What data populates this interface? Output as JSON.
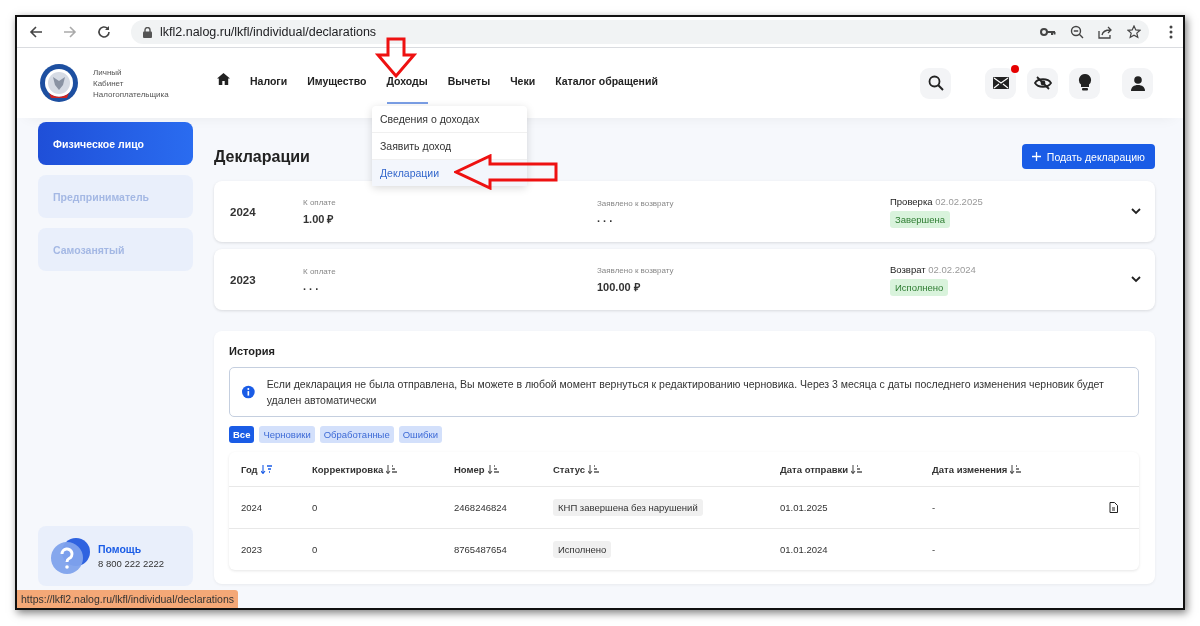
{
  "browser": {
    "url": "lkfl2.nalog.ru/lkfl/individual/declarations",
    "status_url": "https://lkfl2.nalog.ru/lkfl/individual/declarations"
  },
  "logo_text": [
    "Личный",
    "Кабинет",
    "Налогоплательщика"
  ],
  "nav": [
    {
      "label": "Налоги",
      "selected": false
    },
    {
      "label": "Имущество",
      "selected": false
    },
    {
      "label": "Доходы",
      "selected": true
    },
    {
      "label": "Вычеты",
      "selected": false
    },
    {
      "label": "Чеки",
      "selected": false
    },
    {
      "label": "Каталог обращений",
      "selected": false
    }
  ],
  "header_icons": [
    {
      "kind": "search",
      "badge": false
    },
    {
      "kind": "mail",
      "badge": true
    },
    {
      "kind": "eye-off",
      "badge": false
    },
    {
      "kind": "bulb",
      "badge": false
    },
    {
      "kind": "user",
      "badge": false
    }
  ],
  "dropdown": [
    {
      "label": "Сведения о доходах",
      "selected": false
    },
    {
      "label": "Заявить доход",
      "selected": false
    },
    {
      "label": "Декларации",
      "selected": true
    }
  ],
  "sidebar": {
    "items": [
      {
        "label": "Физическое лицо",
        "selected": true
      },
      {
        "label": "Предприниматель",
        "selected": false
      },
      {
        "label": "Самозанятый",
        "selected": false
      }
    ],
    "help": {
      "title": "Помощь",
      "phone": "8 800 222 2222"
    }
  },
  "page_title": "Декларации",
  "primary_button": "Подать декларацию",
  "declarations": [
    {
      "year": "2024",
      "to_pay_label": "К оплате",
      "to_pay": "1.00 ₽",
      "refund_label": "Заявлено к возврату",
      "refund": ". . .",
      "stage": "Проверка",
      "date": "02.02.2025",
      "status": "Завершена"
    },
    {
      "year": "2023",
      "to_pay_label": "К оплате",
      "to_pay": ". . .",
      "refund_label": "Заявлено к возврату",
      "refund": "100.00 ₽",
      "stage": "Возврат",
      "date": "02.02.2024",
      "status": "Исполнено"
    }
  ],
  "history": {
    "title": "История",
    "info": "Если декларация не была отправлена, Вы можете в любой момент вернуться к редактированию черновика. Через 3 месяца с даты последнего изменения черновик будет удален автоматически",
    "filters": [
      {
        "label": "Все",
        "selected": true
      },
      {
        "label": "Черновики",
        "selected": false
      },
      {
        "label": "Обработанные",
        "selected": false
      },
      {
        "label": "Ошибки",
        "selected": false
      }
    ],
    "columns": [
      {
        "label": "Год",
        "sorted": true
      },
      {
        "label": "Корректировка",
        "sorted": false
      },
      {
        "label": "Номер",
        "sorted": false
      },
      {
        "label": "Статус",
        "sorted": false
      },
      {
        "label": "Дата отправки",
        "sorted": false
      },
      {
        "label": "Дата изменения",
        "sorted": false
      }
    ],
    "rows": [
      {
        "cells": [
          "2024",
          "0",
          "2468246824",
          "КНП завершена без нарушений",
          "01.01.2025",
          "-"
        ],
        "document": true
      },
      {
        "cells": [
          "2023",
          "0",
          "8765487654",
          "Исполнено",
          "01.01.2024",
          "-"
        ],
        "document": false
      }
    ]
  }
}
